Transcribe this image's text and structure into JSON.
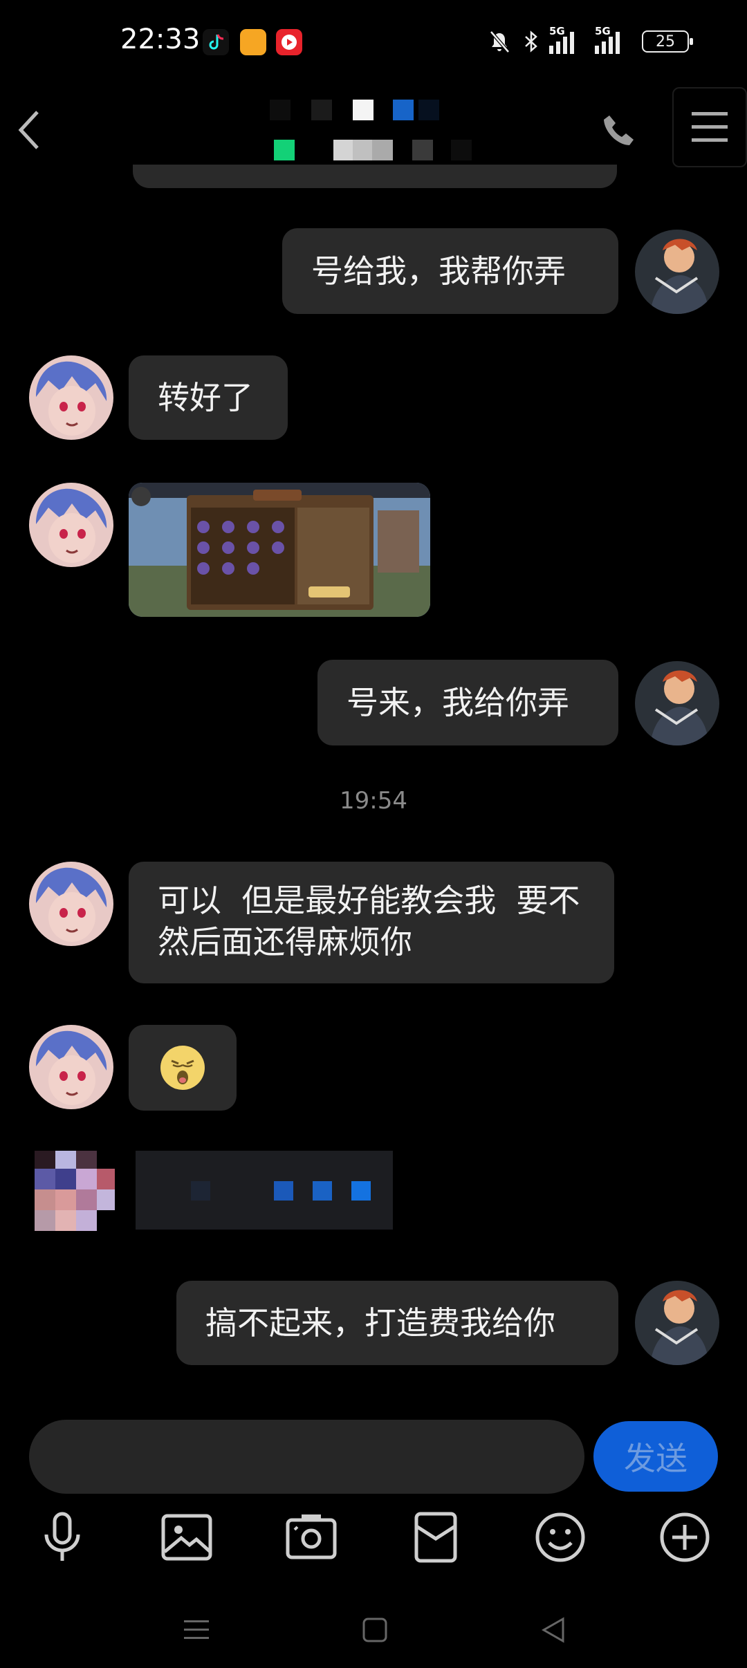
{
  "status_bar": {
    "time": "22:33",
    "network_1": "5G",
    "network_2": "5G",
    "battery": "25"
  },
  "header": {
    "back_icon": "chevron-left-icon",
    "call_icon": "phone-icon",
    "menu_icon": "menu-icon"
  },
  "messages": [
    {
      "side": "right",
      "type": "text",
      "text": "号给我，我帮你弄"
    },
    {
      "side": "left",
      "type": "text",
      "text": "转好了"
    },
    {
      "side": "left",
      "type": "image"
    },
    {
      "side": "right",
      "type": "text",
      "text": "号来，我给你弄"
    },
    {
      "side": "left",
      "type": "text",
      "text": "可以  但是最好能教会我  要不然后面还得麻烦你"
    },
    {
      "side": "left",
      "type": "emoji",
      "emoji": "🥱"
    },
    {
      "side": "left",
      "type": "redacted"
    },
    {
      "side": "right",
      "type": "text",
      "text": "搞不起来，打造费我给你"
    }
  ],
  "time_divider": "19:54",
  "input": {
    "value": "",
    "send_label": "发送"
  },
  "toolbar": {
    "items": [
      "microphone-icon",
      "image-icon",
      "camera-icon",
      "red-packet-icon",
      "emoji-icon",
      "plus-icon"
    ]
  },
  "colors": {
    "background": "#000000",
    "bubble": "#2a2a2a",
    "send_button": "#0f5fd8"
  }
}
